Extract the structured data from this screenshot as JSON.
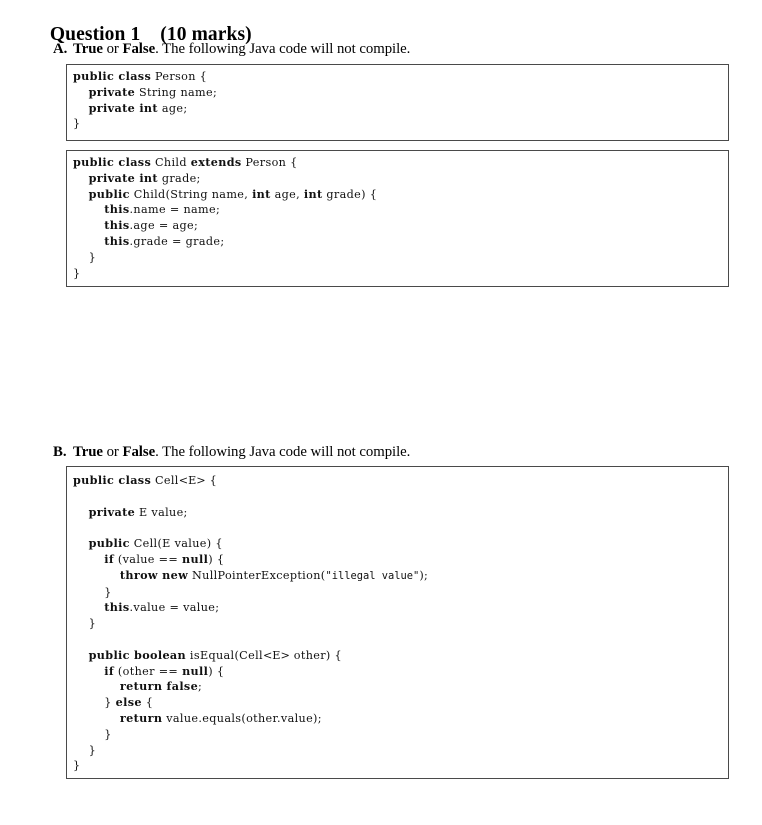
{
  "heading": {
    "title": "Question 1",
    "marks": "(10 marks)"
  },
  "parts": [
    {
      "letter": "A.",
      "bold1": "True",
      "mid": " or ",
      "bold2": "False",
      "tail": ". The following Java code will not compile."
    },
    {
      "letter": "B.",
      "bold1": "True",
      "mid": " or ",
      "bold2": "False",
      "tail": ". The following Java code will not compile."
    }
  ],
  "code_blocks": [
    {
      "id": "person-class",
      "lines": [
        [
          {
            "t": "public class",
            "k": true
          },
          {
            "t": " Person {"
          }
        ],
        [
          {
            "t": "    "
          },
          {
            "t": "private",
            "k": true
          },
          {
            "t": " String name;"
          }
        ],
        [
          {
            "t": "    "
          },
          {
            "t": "private int",
            "k": true
          },
          {
            "t": " age;"
          }
        ],
        [
          {
            "t": "}"
          }
        ]
      ]
    },
    {
      "id": "child-class",
      "lines": [
        [
          {
            "t": "public class",
            "k": true
          },
          {
            "t": " Child "
          },
          {
            "t": "extends",
            "k": true
          },
          {
            "t": " Person {"
          }
        ],
        [
          {
            "t": "    "
          },
          {
            "t": "private int",
            "k": true
          },
          {
            "t": " grade;"
          }
        ],
        [
          {
            "t": "    "
          },
          {
            "t": "public",
            "k": true
          },
          {
            "t": " Child(String name, "
          },
          {
            "t": "int",
            "k": true
          },
          {
            "t": " age, "
          },
          {
            "t": "int",
            "k": true
          },
          {
            "t": " grade) {"
          }
        ],
        [
          {
            "t": "        "
          },
          {
            "t": "this",
            "k": true
          },
          {
            "t": ".name = name;"
          }
        ],
        [
          {
            "t": "        "
          },
          {
            "t": "this",
            "k": true
          },
          {
            "t": ".age = age;"
          }
        ],
        [
          {
            "t": "        "
          },
          {
            "t": "this",
            "k": true
          },
          {
            "t": ".grade = grade;"
          }
        ],
        [
          {
            "t": "    }"
          }
        ],
        [
          {
            "t": "}"
          }
        ]
      ]
    },
    {
      "id": "cell-class",
      "lines": [
        [
          {
            "t": "public class",
            "k": true
          },
          {
            "t": " Cell"
          },
          {
            "t": "<E>",
            "g": true
          },
          {
            "t": " {"
          }
        ],
        [
          {
            "t": ""
          }
        ],
        [
          {
            "t": "    "
          },
          {
            "t": "private",
            "k": true
          },
          {
            "t": " E value;"
          }
        ],
        [
          {
            "t": ""
          }
        ],
        [
          {
            "t": "    "
          },
          {
            "t": "public",
            "k": true
          },
          {
            "t": " Cell(E value) {"
          }
        ],
        [
          {
            "t": "        "
          },
          {
            "t": "if",
            "k": true
          },
          {
            "t": " (value == "
          },
          {
            "t": "null",
            "k": true
          },
          {
            "t": ") {"
          }
        ],
        [
          {
            "t": "            "
          },
          {
            "t": "throw new",
            "k": true
          },
          {
            "t": " NullPointerException("
          },
          {
            "t": "\"illegal value\"",
            "s": true
          },
          {
            "t": ");"
          }
        ],
        [
          {
            "t": "        }"
          }
        ],
        [
          {
            "t": "        "
          },
          {
            "t": "this",
            "k": true
          },
          {
            "t": ".value = value;"
          }
        ],
        [
          {
            "t": "    }"
          }
        ],
        [
          {
            "t": ""
          }
        ],
        [
          {
            "t": "    "
          },
          {
            "t": "public boolean",
            "k": true
          },
          {
            "t": " isEqual(Cell"
          },
          {
            "t": "<E>",
            "g": true
          },
          {
            "t": " other) {"
          }
        ],
        [
          {
            "t": "        "
          },
          {
            "t": "if",
            "k": true
          },
          {
            "t": " (other == "
          },
          {
            "t": "null",
            "k": true
          },
          {
            "t": ") {"
          }
        ],
        [
          {
            "t": "            "
          },
          {
            "t": "return false",
            "k": true
          },
          {
            "t": ";"
          }
        ],
        [
          {
            "t": "        } "
          },
          {
            "t": "else",
            "k": true
          },
          {
            "t": " {"
          }
        ],
        [
          {
            "t": "            "
          },
          {
            "t": "return",
            "k": true
          },
          {
            "t": " value.equals(other.value);"
          }
        ],
        [
          {
            "t": "        }"
          }
        ],
        [
          {
            "t": "    }"
          }
        ],
        [
          {
            "t": "}"
          }
        ]
      ]
    }
  ]
}
